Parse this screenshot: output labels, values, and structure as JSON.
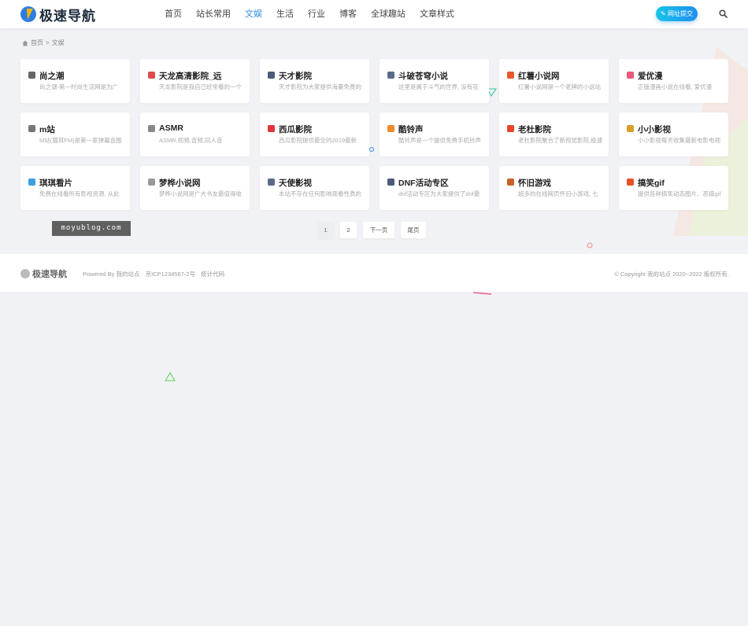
{
  "header": {
    "logo_text": "极速导航",
    "nav": [
      "首页",
      "站长常用",
      "文娱",
      "生活",
      "行业",
      "博客",
      "全球趣站",
      "文章样式"
    ],
    "active_nav": "文娱",
    "submit_label": "✎ 网址提交",
    "search_icon": "search-icon"
  },
  "breadcrumb": {
    "home": "首页",
    "separator": ">",
    "current": "文娱"
  },
  "cards": [
    {
      "title": "尚之潮",
      "desc": "尚之潮-第一时尚生活网是为广",
      "icon_color": "#666666"
    },
    {
      "title": "天龙高清影院_远",
      "desc": "天龙影院是我自己经常看的一个",
      "icon_color": "#e04a4a"
    },
    {
      "title": "天才影院",
      "desc": "天才影院为大家提供海量免费的",
      "icon_color": "#4a5a78"
    },
    {
      "title": "斗破苍穹小说",
      "desc": "这里是属于斗气的世界, 没有花",
      "icon_color": "#5a6a88"
    },
    {
      "title": "红薯小说网",
      "desc": "红薯小说网是一个老牌的小说站",
      "icon_color": "#e8582a"
    },
    {
      "title": "爱优漫",
      "desc": "正版漫画小说在线看, 爱优漫",
      "icon_color": "#e85a78"
    },
    {
      "title": "m站",
      "desc": "M站(猫耳FM)是第一家弹幕音图",
      "icon_color": "#777777"
    },
    {
      "title": "ASMR",
      "desc": "ASMR,视频,音频,同人音",
      "icon_color": "#888888"
    },
    {
      "title": "西瓜影院",
      "desc": "西瓜影院提供最全的2019最新",
      "icon_color": "#e0353a"
    },
    {
      "title": "酷铃声",
      "desc": "酷铃声是一个提供免费手机铃声",
      "icon_color": "#f08a2a"
    },
    {
      "title": "老杜影院",
      "desc": "老杜影院聚合了新视觉影院,极速",
      "icon_color": "#e8452a"
    },
    {
      "title": "小小影视",
      "desc": "小小影视每天收集最新电影电视",
      "icon_color": "#d8a02a"
    },
    {
      "title": "琪琪看片",
      "desc": "免费在线看所有影视资源, 从此",
      "icon_color": "#3aa0e0"
    },
    {
      "title": "梦桦小说网",
      "desc": "梦桦小说网是广大书友最值得收",
      "icon_color": "#999999"
    },
    {
      "title": "天使影视",
      "desc": "本站不存在任何影响观看性质的",
      "icon_color": "#5a6a88"
    },
    {
      "title": "DNF活动专区",
      "desc": "dnf活动专区为大家提供了dnf最",
      "icon_color": "#4a5a78"
    },
    {
      "title": "怀旧游戏",
      "desc": "超多的在线网页怀旧小游戏, 七",
      "icon_color": "#c8602a"
    },
    {
      "title": "搞笑gif",
      "desc": "提供各种搞笑动态图片、恶搞gif",
      "icon_color": "#e8502a"
    }
  ],
  "pagination": {
    "pages": [
      "1",
      "2"
    ],
    "current": "1",
    "next": "下一页",
    "last": "尾页"
  },
  "watermark": "moyublog.com",
  "footer": {
    "logo_text": "极速导航",
    "powered": "Powered By 我的站点",
    "icp": "京ICP1234567-2号",
    "stats": "统计代码",
    "copyright": "© Copyright 我的站点 2020~2022 版权所有."
  }
}
